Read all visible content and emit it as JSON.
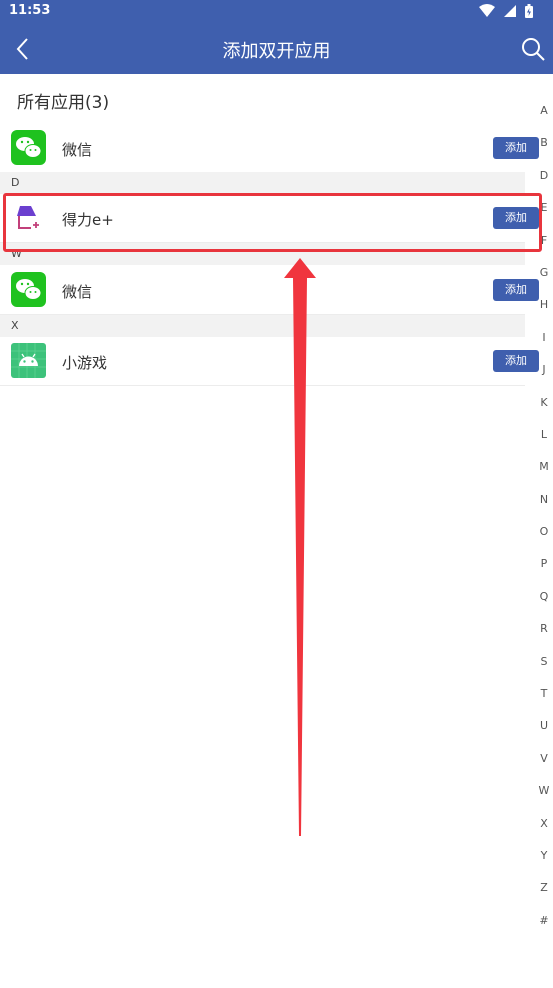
{
  "status": {
    "time": "11:53"
  },
  "header": {
    "title": "添加双开应用"
  },
  "section": {
    "title": "所有应用(3)"
  },
  "rows": [
    {
      "name": "微信",
      "add_label": "添加"
    },
    {
      "name": "得力e+",
      "add_label": "添加"
    },
    {
      "name": "微信",
      "add_label": "添加"
    },
    {
      "name": "小游戏",
      "add_label": "添加"
    }
  ],
  "groups": [
    "D",
    "W",
    "X"
  ],
  "index_letters": [
    "A",
    "B",
    "D",
    "E",
    "F",
    "G",
    "H",
    "I",
    "J",
    "K",
    "L",
    "M",
    "N",
    "O",
    "P",
    "Q",
    "R",
    "S",
    "T",
    "U",
    "V",
    "W",
    "X",
    "Y",
    "Z",
    "#"
  ],
  "colors": {
    "header": "#3f5fae",
    "button": "#3f5fae",
    "highlight": "#e8353d"
  }
}
